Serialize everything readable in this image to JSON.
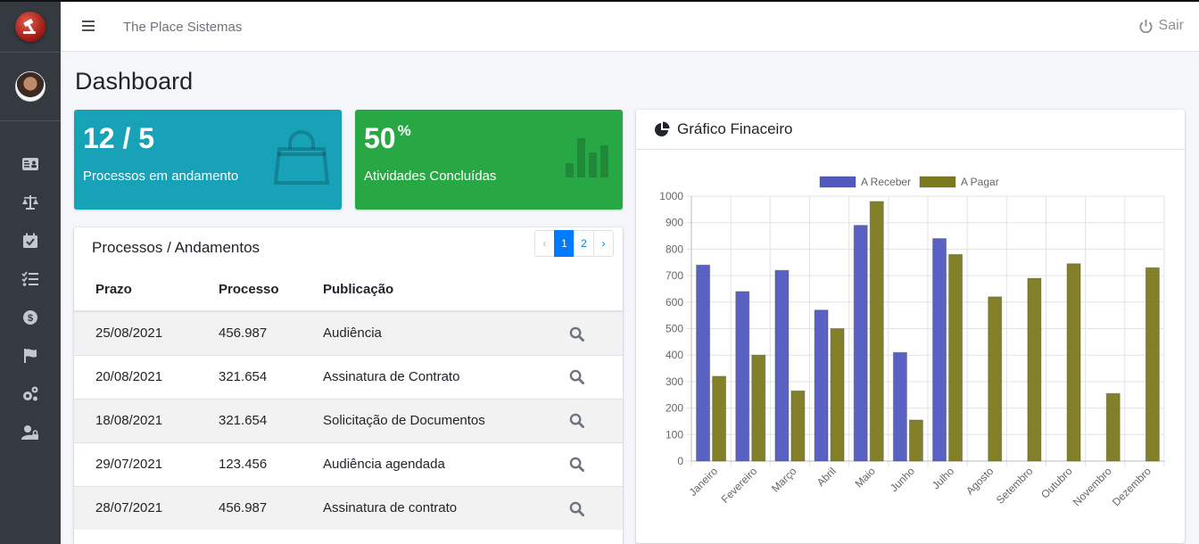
{
  "topbar": {
    "title": "The Place Sistemas",
    "logout_label": "Sair"
  },
  "page": {
    "title": "Dashboard"
  },
  "boxes": [
    {
      "value": "12 / 5",
      "label": "Processos em andamento",
      "icon": "shopping-bag-icon",
      "color": "#17a2b8"
    },
    {
      "value": "50",
      "suffix": "%",
      "label": "Atividades Concluídas",
      "icon": "bar-chart-icon",
      "color": "#28a745"
    }
  ],
  "sidebar": {
    "items": [
      {
        "icon": "id-card-icon"
      },
      {
        "icon": "balance-scale-icon"
      },
      {
        "icon": "calendar-check-icon"
      },
      {
        "icon": "tasks-icon"
      },
      {
        "icon": "dollar-coin-icon"
      },
      {
        "icon": "flag-icon"
      },
      {
        "icon": "cogs-icon"
      },
      {
        "icon": "user-lock-icon"
      }
    ]
  },
  "processes": {
    "title": "Processos / Andamentos",
    "pagination": {
      "prev": "‹",
      "pages": [
        "1",
        "2"
      ],
      "active": "1",
      "next": "›"
    },
    "columns": [
      "Prazo",
      "Processo",
      "Publicação"
    ],
    "rows": [
      {
        "prazo": "25/08/2021",
        "processo": "456.987",
        "publicacao": "Audiência"
      },
      {
        "prazo": "20/08/2021",
        "processo": "321.654",
        "publicacao": "Assinatura de Contrato"
      },
      {
        "prazo": "18/08/2021",
        "processo": "321.654",
        "publicacao": "Solicitação de Documentos"
      },
      {
        "prazo": "29/07/2021",
        "processo": "123.456",
        "publicacao": "Audiência agendada"
      },
      {
        "prazo": "28/07/2021",
        "processo": "456.987",
        "publicacao": "Assinatura de contrato"
      }
    ]
  },
  "chart_card": {
    "title": "Gráfico Finaceiro",
    "icon": "pie-chart-icon"
  },
  "chart_data": {
    "type": "bar",
    "categories": [
      "Janeiro",
      "Fevereiro",
      "Março",
      "Abril",
      "Maio",
      "Junho",
      "Julho",
      "Agosto",
      "Setembro",
      "Outubro",
      "Novembro",
      "Dezembro"
    ],
    "series": [
      {
        "name": "A Receber",
        "color": "#5059c0",
        "values": [
          740,
          640,
          720,
          570,
          890,
          410,
          840,
          null,
          null,
          null,
          null,
          null
        ]
      },
      {
        "name": "A Pagar",
        "color": "#7b7a1e",
        "values": [
          320,
          400,
          265,
          500,
          980,
          155,
          780,
          620,
          690,
          745,
          255,
          730
        ]
      }
    ],
    "ylim": [
      0,
      1000
    ],
    "yticks": [
      0,
      100,
      200,
      300,
      400,
      500,
      600,
      700,
      800,
      900,
      1000
    ],
    "grid": true,
    "legend": "top"
  }
}
